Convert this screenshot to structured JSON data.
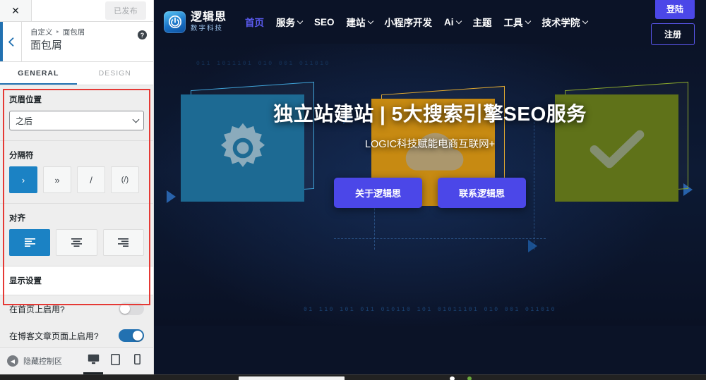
{
  "customizer": {
    "close_icon": "close-icon",
    "published_label": "已发布",
    "back_icon": "chevron-left-icon",
    "breadcrumb_parent": "自定义",
    "breadcrumb_sep": "‣",
    "breadcrumb_current": "面包屑",
    "panel_title": "面包屑",
    "help_icon": "help-icon",
    "tabs": [
      {
        "label": "GENERAL",
        "active": true
      },
      {
        "label": "DESIGN",
        "active": false
      }
    ],
    "controls": {
      "header_position": {
        "label": "页眉位置",
        "value": "之后",
        "chevron_icon": "chevron-down-icon"
      },
      "separator": {
        "label": "分隔符",
        "options": [
          {
            "glyph": "›",
            "name": "single-chevron",
            "active": true
          },
          {
            "glyph": "»",
            "name": "double-chevron",
            "active": false
          },
          {
            "glyph": "/",
            "name": "slash",
            "active": false
          },
          {
            "glyph": "(/)",
            "name": "paren-slash",
            "active": false
          }
        ]
      },
      "alignment": {
        "label": "对齐",
        "options": [
          {
            "name": "align-left-icon",
            "active": true
          },
          {
            "name": "align-center-icon",
            "active": false
          },
          {
            "name": "align-right-icon",
            "active": false
          }
        ]
      },
      "display_settings": {
        "label": "显示设置"
      },
      "toggles": [
        {
          "label": "在首页上启用?",
          "on": false
        },
        {
          "label": "在博客文章页面上启用?",
          "on": true
        }
      ]
    },
    "footer": {
      "collapse_label": "隐藏控制区",
      "collapse_icon": "caret-left-icon",
      "devices": [
        {
          "name": "desktop-icon",
          "active": true
        },
        {
          "name": "tablet-icon",
          "active": false
        },
        {
          "name": "mobile-icon",
          "active": false
        }
      ]
    }
  },
  "preview": {
    "logo": {
      "title": "逻辑思",
      "subtitle": "数字科技",
      "icon": "logo-mark-icon"
    },
    "nav": [
      {
        "label": "首页",
        "caret": false,
        "current": true
      },
      {
        "label": "服务",
        "caret": true,
        "current": false
      },
      {
        "label": "SEO",
        "caret": false,
        "current": false
      },
      {
        "label": "建站",
        "caret": true,
        "current": false
      },
      {
        "label": "小程序开发",
        "caret": false,
        "current": false
      },
      {
        "label": "Ai",
        "caret": true,
        "current": false
      },
      {
        "label": "主题",
        "caret": false,
        "current": false
      },
      {
        "label": "工具",
        "caret": true,
        "current": false
      },
      {
        "label": "技术学院",
        "caret": true,
        "current": false
      }
    ],
    "actions": {
      "login": "登陆",
      "register": "注册"
    },
    "hero": {
      "title": "独立站建站 | 5大搜索引擎SEO服务",
      "subtitle": "LOGIC科技赋能电商互联网+",
      "buttons": [
        {
          "label": "关于逻辑思"
        },
        {
          "label": "联系逻辑思"
        }
      ],
      "cards": [
        {
          "name": "gear-card",
          "icon": "gear-icon"
        },
        {
          "name": "cloud-card",
          "icon": "cloud-icon"
        },
        {
          "name": "check-card",
          "icon": "check-icon"
        }
      ],
      "binary_bottom": "01  110  101  011  010110  101  01011101   010   001  011010",
      "binary_top": "011  1011101   010   001   011010"
    }
  },
  "colors": {
    "accent_blue": "#1b82c4",
    "wp_blue": "#2271b1",
    "brand_indigo": "#4b47e8",
    "nav_active": "#5b5bf0",
    "highlight_red": "#e53935",
    "preview_bg": "#0b1327",
    "card_blue": "#1d6a93",
    "card_orange": "#c78a12",
    "card_green": "#5f7219"
  }
}
